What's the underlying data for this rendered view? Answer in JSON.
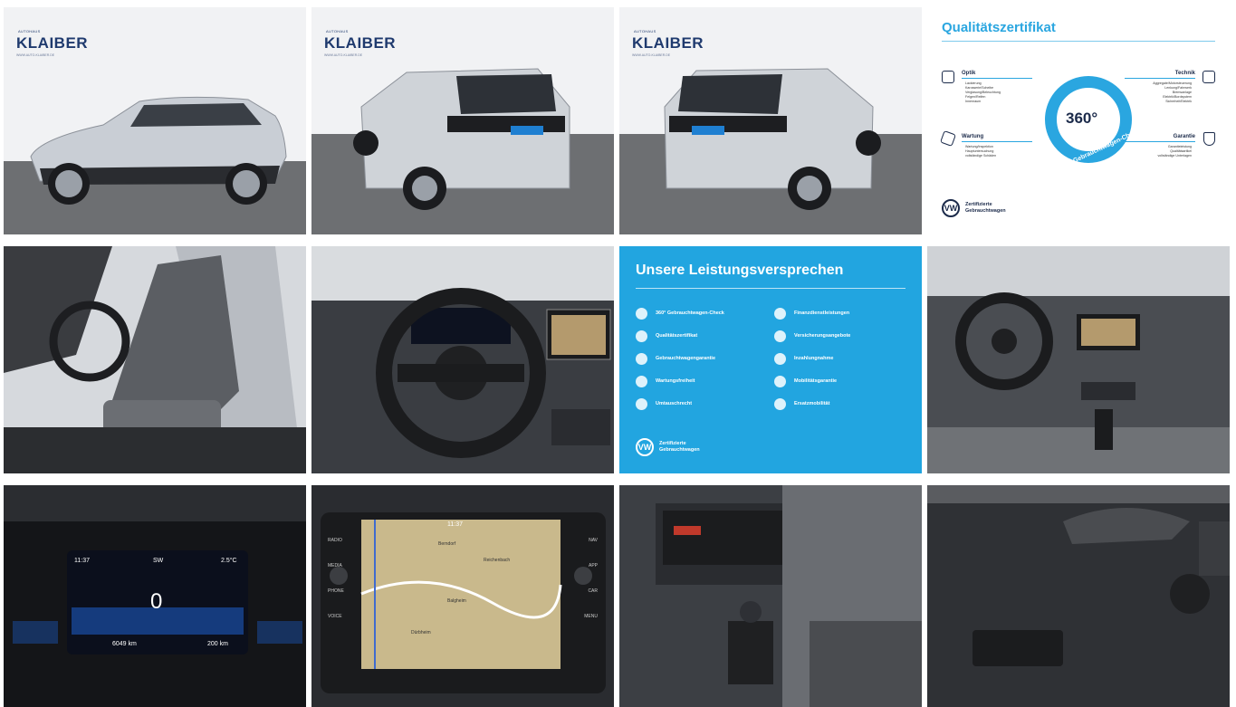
{
  "gallery": {
    "logo": {
      "brand": "KLAIBER",
      "tagline": "AUTOHAUS",
      "url": "WWW.AUTO-KLAIBER.DE"
    },
    "images": [
      {
        "label": "side-view"
      },
      {
        "label": "rear-left-view"
      },
      {
        "label": "rear-right-view"
      },
      {
        "label": "quality-certificate"
      },
      {
        "label": "front-seat"
      },
      {
        "label": "steering-wheel"
      },
      {
        "label": "service-promises"
      },
      {
        "label": "dashboard"
      },
      {
        "label": "instrument-cluster"
      },
      {
        "label": "navigation"
      },
      {
        "label": "center-console"
      },
      {
        "label": "door-panel"
      }
    ]
  },
  "certificate": {
    "title": "Qualitätszertifikat",
    "ring_number": "360°",
    "ring_text": "Gebrauchtwagen-Check",
    "optik": {
      "heading": "Optik",
      "lines": [
        "Lackierung",
        "Karosserie/Scheibe",
        "Verglasung/Beleuchtung",
        "Felgen/Reifen",
        "Innenraum"
      ]
    },
    "technik": {
      "heading": "Technik",
      "lines": [
        "Aggregate/Motorsteuerung",
        "Lenkung/Fahrwerk",
        "Bremsanlage",
        "Elektrik/Bordsystem",
        "Sicherheit/Elektrik"
      ]
    },
    "wartung": {
      "heading": "Wartung",
      "lines": [
        "Wartung/Inspektion",
        "Hauptuntersuchung",
        "vollständige Schäden"
      ]
    },
    "garantie": {
      "heading": "Garantie",
      "lines": [
        "Garantieleistung",
        "Qualitätsartikel",
        "vollständige Unterlagen"
      ]
    },
    "badge": "Zertifizierte Gebrauchtwagen"
  },
  "promises": {
    "title": "Unsere Leistungsversprechen",
    "items": [
      "360° Gebrauchtwagen-Check",
      "Finanzdienstleistungen",
      "Qualitätszertifikat",
      "Versicherungsangebote",
      "Gebrauchtwagengarantie",
      "Inzahlungnahme",
      "Wartungsfreiheit",
      "Mobilitätsgarantie",
      "Umtauschrecht",
      "Ersatzmobilität"
    ],
    "badge": "Zertifizierte Gebrauchtwagen"
  },
  "cluster": {
    "time": "11:37",
    "direction": "SW",
    "temp": "2.5°C",
    "speed": "0",
    "odometer": "6049 km",
    "range": "200 km"
  },
  "nav": {
    "time": "11:37",
    "buttons_left": [
      "RADIO",
      "MEDIA",
      "PHONE",
      "VOICE"
    ],
    "buttons_right": [
      "NAV",
      "APP",
      "CAR",
      "MENU"
    ],
    "places": [
      "Reichenbach",
      "Berndorf",
      "Balgheim",
      "Dürbheim"
    ]
  },
  "colors": {
    "accent": "#22a5e0",
    "dark": "#1b2a4a",
    "silver": "#c9ced5"
  }
}
